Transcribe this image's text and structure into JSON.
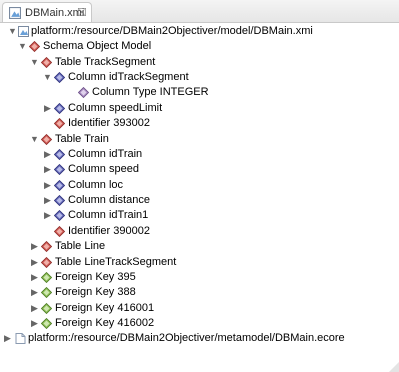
{
  "tab": {
    "title": "DBMain.xmi",
    "close": "☒"
  },
  "tree": {
    "root_resource": "platform:/resource/DBMain2Objectiver/model/DBMain.xmi",
    "schema": "Schema Object Model",
    "table_tracksegment": "Table TrackSegment",
    "col_idtracksegment": "Column idTrackSegment",
    "col_type_integer": "Column Type INTEGER",
    "col_speedlimit": "Column speedLimit",
    "identifier_393002": "Identifier 393002",
    "table_train": "Table Train",
    "col_idtrain": "Column idTrain",
    "col_speed": "Column speed",
    "col_loc": "Column loc",
    "col_distance": "Column distance",
    "col_idtrain1": "Column idTrain1",
    "identifier_390002": "Identifier 390002",
    "table_line": "Table Line",
    "table_linetracksegment": "Table LineTrackSegment",
    "fk_395": "Foreign Key 395",
    "fk_388": "Foreign Key 388",
    "fk_416001": "Foreign Key 416001",
    "fk_416002": "Foreign Key 416002",
    "ecore_resource": "platform:/resource/DBMain2Objectiver/metamodel/DBMain.ecore"
  },
  "colors": {
    "table_icon": "#c0504d",
    "column_icon": "#5a5ea8",
    "foreign_key_icon": "#7fae4a",
    "type_icon": "#9a7fb0"
  }
}
